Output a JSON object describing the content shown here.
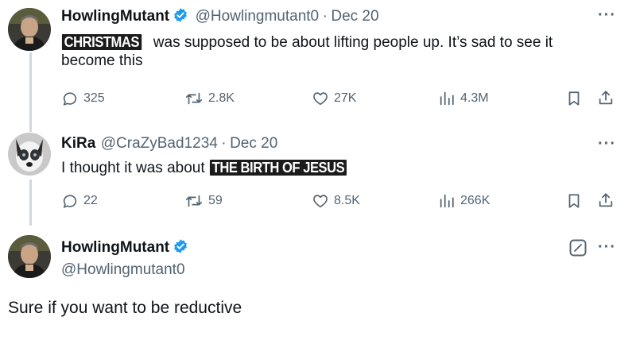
{
  "tweets": [
    {
      "name": "HowlingMutant",
      "handle": "@Howlingmutant0",
      "date": "Dec 20",
      "sep": "·",
      "text_overlay": "CHRISTMAS",
      "text_after": " was supposed to be about lifting people up. It’s sad to see it become this",
      "replies": "325",
      "reposts": "2.8K",
      "likes": "27K",
      "views": "4.3M"
    },
    {
      "name": "KiRa",
      "handle": "@CraZyBad1234",
      "date": "Dec 20",
      "sep": "·",
      "text_before": "I thought it was about ",
      "text_overlay": "THE BIRTH OF JESUS",
      "replies": "22",
      "reposts": "59",
      "likes": "8.5K",
      "views": "266K"
    },
    {
      "name": "HowlingMutant",
      "handle": "@Howlingmutant0",
      "text": "Sure if you want to be reductive"
    }
  ],
  "colors": {
    "verified": "#1d9bf0",
    "muted": "#536471",
    "thread_line": "#cfd9de"
  },
  "icons": {
    "reply": "speech-bubble-icon",
    "repost": "repost-arrows-icon",
    "like": "heart-icon",
    "views": "bar-chart-icon",
    "bookmark": "bookmark-icon",
    "share": "share-icon",
    "more": "more-dots-icon",
    "edit": "edit-icon",
    "verified": "verified-badge-icon"
  }
}
